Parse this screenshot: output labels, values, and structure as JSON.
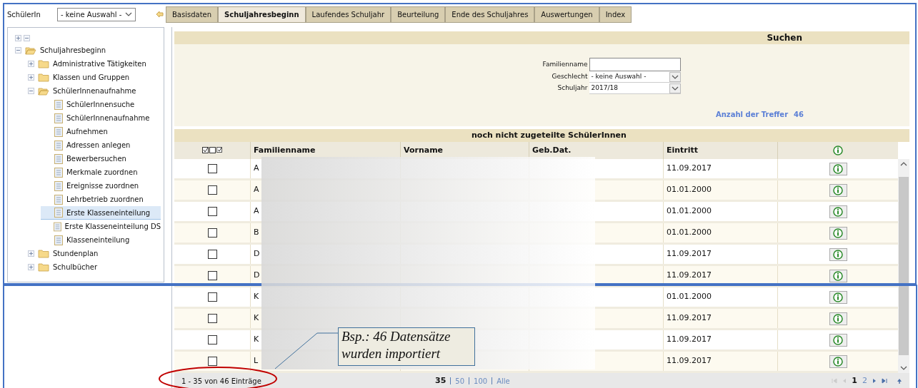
{
  "topbar": {
    "label": "SchülerIn",
    "select": {
      "value": "- keine Auswahl -"
    }
  },
  "tabs": [
    {
      "label": "Basisdaten",
      "selected": false
    },
    {
      "label": "Schuljahresbeginn",
      "selected": true
    },
    {
      "label": "Laufendes Schuljahr",
      "selected": false
    },
    {
      "label": "Beurteilung",
      "selected": false
    },
    {
      "label": "Ende des Schuljahres",
      "selected": false
    },
    {
      "label": "Auswertungen",
      "selected": false
    },
    {
      "label": "Index",
      "selected": false
    }
  ],
  "tree": [
    {
      "label": "Schuljahresbeginn",
      "kind": "folder",
      "expanded": true,
      "selected": false,
      "children": [
        {
          "label": "Administrative Tätigkeiten",
          "kind": "folder",
          "expanded": false,
          "selected": false
        },
        {
          "label": "Klassen und Gruppen",
          "kind": "folder",
          "expanded": false,
          "selected": false
        },
        {
          "label": "SchülerInnenaufnahme",
          "kind": "folder",
          "expanded": true,
          "selected": false,
          "children": [
            {
              "label": "SchülerInnensuche",
              "kind": "page",
              "selected": false
            },
            {
              "label": "SchülerInnenaufnahme",
              "kind": "page",
              "selected": false
            },
            {
              "label": "Aufnehmen",
              "kind": "page",
              "selected": false
            },
            {
              "label": "Adressen anlegen",
              "kind": "page",
              "selected": false
            },
            {
              "label": "Bewerbersuchen",
              "kind": "page",
              "selected": false
            },
            {
              "label": "Merkmale zuordnen",
              "kind": "page",
              "selected": false
            },
            {
              "label": "Ereignisse zuordnen",
              "kind": "page",
              "selected": false
            },
            {
              "label": "Lehrbetrieb zuordnen",
              "kind": "page",
              "selected": false
            },
            {
              "label": "Erste Klasseneinteilung",
              "kind": "page",
              "selected": true
            },
            {
              "label": "Erste Klasseneinteilung DS",
              "kind": "page",
              "selected": false
            },
            {
              "label": "Klasseneinteilung",
              "kind": "page",
              "selected": false
            }
          ]
        },
        {
          "label": "Stundenplan",
          "kind": "folder",
          "expanded": false,
          "selected": false
        },
        {
          "label": "Schulbücher",
          "kind": "folder",
          "expanded": false,
          "selected": false
        }
      ]
    }
  ],
  "search": {
    "title": "Suchen",
    "fields": [
      {
        "label": "Familienname",
        "kind": "text"
      },
      {
        "label": "Geschlecht",
        "kind": "select",
        "value": "- keine Auswahl -"
      },
      {
        "label": "Schuljahr",
        "kind": "select",
        "value": "2017/18"
      }
    ],
    "hits_label": "Anzahl der Treffer",
    "hits": "46"
  },
  "table": {
    "title": "noch nicht zugeteilte SchülerInnen",
    "columns": [
      "Familienname",
      "Vorname",
      "Geb.Dat.",
      "Eintritt"
    ],
    "rows": [
      {
        "checked": false,
        "familienname": "A",
        "eintritt": "11.09.2017"
      },
      {
        "checked": false,
        "familienname": "A",
        "eintritt": "01.01.2000"
      },
      {
        "checked": false,
        "familienname": "A",
        "eintritt": "01.01.2000"
      },
      {
        "checked": false,
        "familienname": "B",
        "eintritt": "01.01.2000"
      },
      {
        "checked": false,
        "familienname": "D",
        "eintritt": "11.09.2017"
      },
      {
        "checked": false,
        "familienname": "D",
        "eintritt": "11.09.2017"
      },
      {
        "checked": false,
        "familienname": "K",
        "eintritt": "01.01.2000"
      },
      {
        "checked": false,
        "familienname": "K",
        "eintritt": "11.09.2017"
      },
      {
        "checked": false,
        "familienname": "K",
        "eintritt": "11.09.2017"
      },
      {
        "checked": false,
        "familienname": "L",
        "eintritt": "11.09.2017"
      }
    ]
  },
  "footer": {
    "range": "1 - 35 von 46 Einträge",
    "page_sizes": [
      {
        "label": "35",
        "selected": true
      },
      {
        "label": "50",
        "selected": false
      },
      {
        "label": "100",
        "selected": false
      },
      {
        "label": "Alle",
        "selected": false
      }
    ],
    "pages": [
      {
        "label": "1",
        "selected": true
      },
      {
        "label": "2",
        "selected": false
      }
    ]
  },
  "callout": {
    "lines": [
      "Bsp.: 46 Datensätze",
      "wurden importiert"
    ]
  }
}
